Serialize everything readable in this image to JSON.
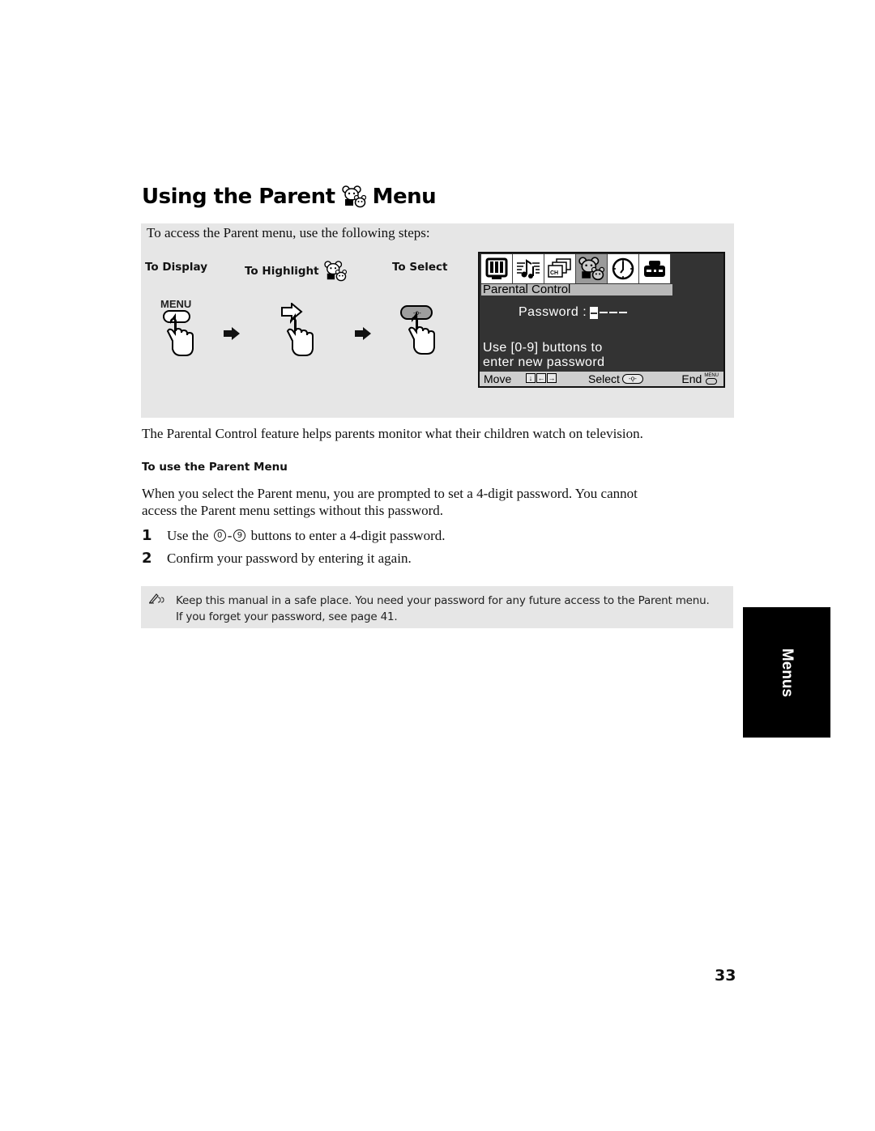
{
  "page": {
    "title_before": "Using the Parent",
    "title_after": "Menu",
    "title_icon": "parent-bears-icon",
    "page_number": "33",
    "side_tab": "Menus"
  },
  "steps": {
    "intro": "To access the Parent menu, use the following steps:",
    "labels": {
      "display": "To Display",
      "highlight": "To Highlight",
      "select": "To Select"
    },
    "menu_button_label": "MENU",
    "icons": [
      "menu-button-press-icon",
      "arrow-right-icon",
      "highlight-arrow-press-icon",
      "arrow-right-icon",
      "select-button-press-icon"
    ]
  },
  "tv_screen": {
    "tabs": [
      {
        "icon": "video-icon",
        "active": false
      },
      {
        "icon": "audio-icon",
        "active": false
      },
      {
        "icon": "channel-icon",
        "active": false,
        "text": "CH"
      },
      {
        "icon": "parent-icon",
        "active": true
      },
      {
        "icon": "timer-icon",
        "active": false
      },
      {
        "icon": "setup-icon",
        "active": false
      }
    ],
    "heading": "Parental Control",
    "password_label": "Password :",
    "password_value": "----",
    "help_line1": "Use [0-9] buttons to",
    "help_line2": "enter new password",
    "footer": {
      "move": "Move",
      "select": "Select",
      "end": "End",
      "end_button": "MENU"
    }
  },
  "body": {
    "intro_paragraph": "The Parental Control feature helps parents monitor what their children watch on television.",
    "subheading": "To use the Parent Menu",
    "paragraph_line1": "When you select the Parent menu, you are prompted to set a 4-digit password. You cannot",
    "paragraph_line2": "access the Parent menu settings without this password.",
    "steps": [
      {
        "num": "1",
        "pre": "Use the",
        "btn_from": "0",
        "dash": "-",
        "btn_to": "9",
        "post": "buttons to enter a 4-digit password."
      },
      {
        "num": "2",
        "text": "Confirm your password by entering it again."
      }
    ]
  },
  "note": {
    "icon": "pencil-note-icon",
    "line1": "Keep this manual in a safe place. You need your password for any future access to the Parent menu.",
    "line2": "If you forget your password, see page 41."
  }
}
